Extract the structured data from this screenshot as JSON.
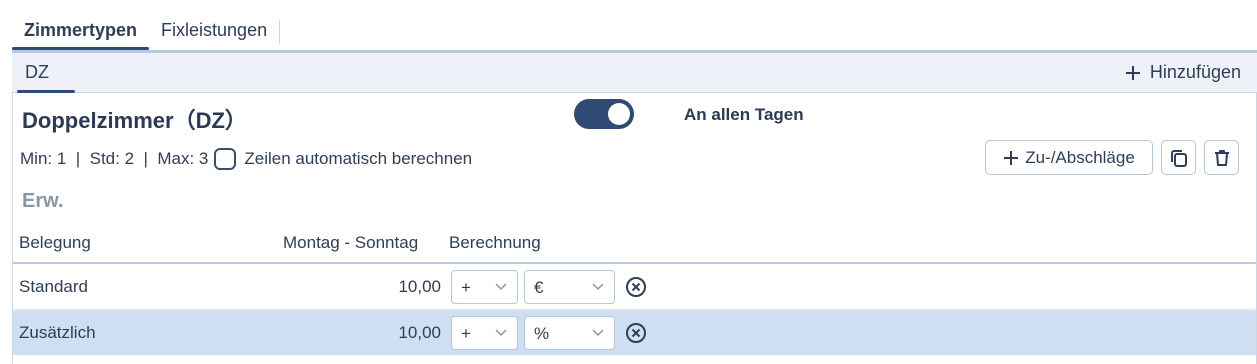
{
  "tabs": [
    {
      "label": "Zimmertypen"
    },
    {
      "label": "Fixleistungen"
    }
  ],
  "subtab": {
    "label": "DZ"
  },
  "add_label": "Hinzufügen",
  "room": {
    "title": "Doppelzimmer（DZ）",
    "toggle_on": true,
    "days_label": "An allen Tagen",
    "minmax": "Min: 1  |  Std: 2  |  Max: 3",
    "auto_calc_label": "Zeilen automatisch berechnen",
    "auto_calc_checked": false,
    "adjust_label": "Zu-/Abschläge"
  },
  "section": "Erw.",
  "table": {
    "headers": {
      "belegung": "Belegung",
      "days": "Montag - Sonntag",
      "calc": "Berechnung"
    },
    "rows": [
      {
        "label": "Standard",
        "value": "10,00",
        "op": "+",
        "unit": "€"
      },
      {
        "label": "Zusätzlich",
        "value": "10,00",
        "op": "+",
        "unit": "%"
      }
    ]
  },
  "colors": {
    "accent": "#2f4a73",
    "highlight_row": "#cfdff2",
    "tab_bg": "#eef2f8"
  }
}
